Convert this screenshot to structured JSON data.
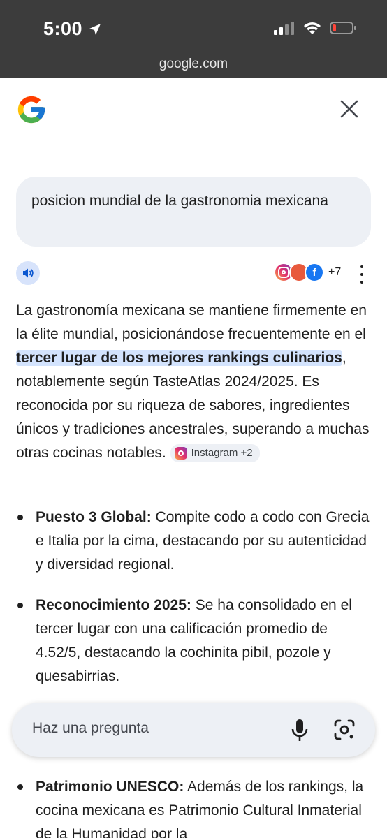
{
  "status_bar": {
    "time": "5:00",
    "battery_color": "#ff453a"
  },
  "browser": {
    "url": "google.com"
  },
  "query": {
    "text": "posicion mundial de la gastronomia mexicana"
  },
  "sources": {
    "more_count": "+7",
    "icons": [
      "instagram-icon",
      "site-icon",
      "facebook-icon"
    ]
  },
  "answer": {
    "part1": "La gastronomía mexicana se mantiene firmemente en la élite mundial, posicionándose frecuentemente en el ",
    "highlight": "tercer lugar de los mejores rankings culinarios",
    "part2": ", notablemente según TasteAtlas 2024/2025. Es reconocida por su riqueza de sabores, ingredientes únicos y tradiciones ancestrales, superando a muchas otras cocinas notables.",
    "chip_label": "Instagram +2"
  },
  "bullets": [
    {
      "title": "Puesto 3 Global:",
      "text": " Compite codo a codo con Grecia e Italia por la cima, destacando por su autenticidad y diversidad regional."
    },
    {
      "title": "Reconocimiento 2025:",
      "text": " Se ha consolidado en el tercer lugar con una calificación promedio de 4.52/5, destacando la cochinita pibil, pozole y quesabirrias."
    },
    {
      "title": "Patrimonio UNESCO:",
      "text": " Además de los rankings, la cocina mexicana es Patrimonio Cultural Inmaterial de la Humanidad por la"
    }
  ],
  "ask": {
    "placeholder": "Haz una pregunta"
  },
  "colors": {
    "highlight": "#d3e3fd",
    "bubble": "#edf0f5",
    "statusbar": "#3c3c3c"
  }
}
